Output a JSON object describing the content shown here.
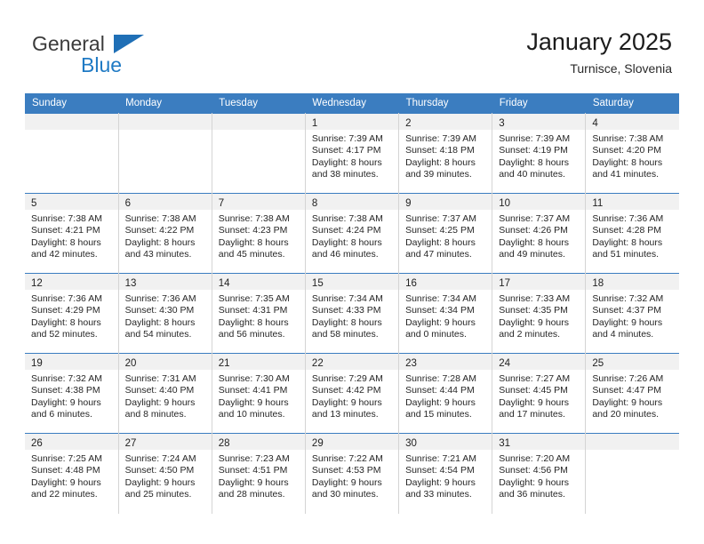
{
  "brand": {
    "name_top": "General",
    "name_bottom": "Blue",
    "triangle_color": "#1f6fb6",
    "text_color": "#3b3b3b",
    "blue_color": "#1f7ac4"
  },
  "header": {
    "title": "January 2025",
    "location": "Turnisce, Slovenia"
  },
  "theme": {
    "header_band": "#3b7dc0",
    "daynum_band": "#f1f1f1",
    "grid_line": "#d4d4d4",
    "text": "#262626"
  },
  "weekdays": [
    "Sunday",
    "Monday",
    "Tuesday",
    "Wednesday",
    "Thursday",
    "Friday",
    "Saturday"
  ],
  "weeks": [
    [
      {
        "day": "",
        "lines": []
      },
      {
        "day": "",
        "lines": []
      },
      {
        "day": "",
        "lines": []
      },
      {
        "day": "1",
        "lines": [
          "Sunrise: 7:39 AM",
          "Sunset: 4:17 PM",
          "Daylight: 8 hours",
          "and 38 minutes."
        ]
      },
      {
        "day": "2",
        "lines": [
          "Sunrise: 7:39 AM",
          "Sunset: 4:18 PM",
          "Daylight: 8 hours",
          "and 39 minutes."
        ]
      },
      {
        "day": "3",
        "lines": [
          "Sunrise: 7:39 AM",
          "Sunset: 4:19 PM",
          "Daylight: 8 hours",
          "and 40 minutes."
        ]
      },
      {
        "day": "4",
        "lines": [
          "Sunrise: 7:38 AM",
          "Sunset: 4:20 PM",
          "Daylight: 8 hours",
          "and 41 minutes."
        ]
      }
    ],
    [
      {
        "day": "5",
        "lines": [
          "Sunrise: 7:38 AM",
          "Sunset: 4:21 PM",
          "Daylight: 8 hours",
          "and 42 minutes."
        ]
      },
      {
        "day": "6",
        "lines": [
          "Sunrise: 7:38 AM",
          "Sunset: 4:22 PM",
          "Daylight: 8 hours",
          "and 43 minutes."
        ]
      },
      {
        "day": "7",
        "lines": [
          "Sunrise: 7:38 AM",
          "Sunset: 4:23 PM",
          "Daylight: 8 hours",
          "and 45 minutes."
        ]
      },
      {
        "day": "8",
        "lines": [
          "Sunrise: 7:38 AM",
          "Sunset: 4:24 PM",
          "Daylight: 8 hours",
          "and 46 minutes."
        ]
      },
      {
        "day": "9",
        "lines": [
          "Sunrise: 7:37 AM",
          "Sunset: 4:25 PM",
          "Daylight: 8 hours",
          "and 47 minutes."
        ]
      },
      {
        "day": "10",
        "lines": [
          "Sunrise: 7:37 AM",
          "Sunset: 4:26 PM",
          "Daylight: 8 hours",
          "and 49 minutes."
        ]
      },
      {
        "day": "11",
        "lines": [
          "Sunrise: 7:36 AM",
          "Sunset: 4:28 PM",
          "Daylight: 8 hours",
          "and 51 minutes."
        ]
      }
    ],
    [
      {
        "day": "12",
        "lines": [
          "Sunrise: 7:36 AM",
          "Sunset: 4:29 PM",
          "Daylight: 8 hours",
          "and 52 minutes."
        ]
      },
      {
        "day": "13",
        "lines": [
          "Sunrise: 7:36 AM",
          "Sunset: 4:30 PM",
          "Daylight: 8 hours",
          "and 54 minutes."
        ]
      },
      {
        "day": "14",
        "lines": [
          "Sunrise: 7:35 AM",
          "Sunset: 4:31 PM",
          "Daylight: 8 hours",
          "and 56 minutes."
        ]
      },
      {
        "day": "15",
        "lines": [
          "Sunrise: 7:34 AM",
          "Sunset: 4:33 PM",
          "Daylight: 8 hours",
          "and 58 minutes."
        ]
      },
      {
        "day": "16",
        "lines": [
          "Sunrise: 7:34 AM",
          "Sunset: 4:34 PM",
          "Daylight: 9 hours",
          "and 0 minutes."
        ]
      },
      {
        "day": "17",
        "lines": [
          "Sunrise: 7:33 AM",
          "Sunset: 4:35 PM",
          "Daylight: 9 hours",
          "and 2 minutes."
        ]
      },
      {
        "day": "18",
        "lines": [
          "Sunrise: 7:32 AM",
          "Sunset: 4:37 PM",
          "Daylight: 9 hours",
          "and 4 minutes."
        ]
      }
    ],
    [
      {
        "day": "19",
        "lines": [
          "Sunrise: 7:32 AM",
          "Sunset: 4:38 PM",
          "Daylight: 9 hours",
          "and 6 minutes."
        ]
      },
      {
        "day": "20",
        "lines": [
          "Sunrise: 7:31 AM",
          "Sunset: 4:40 PM",
          "Daylight: 9 hours",
          "and 8 minutes."
        ]
      },
      {
        "day": "21",
        "lines": [
          "Sunrise: 7:30 AM",
          "Sunset: 4:41 PM",
          "Daylight: 9 hours",
          "and 10 minutes."
        ]
      },
      {
        "day": "22",
        "lines": [
          "Sunrise: 7:29 AM",
          "Sunset: 4:42 PM",
          "Daylight: 9 hours",
          "and 13 minutes."
        ]
      },
      {
        "day": "23",
        "lines": [
          "Sunrise: 7:28 AM",
          "Sunset: 4:44 PM",
          "Daylight: 9 hours",
          "and 15 minutes."
        ]
      },
      {
        "day": "24",
        "lines": [
          "Sunrise: 7:27 AM",
          "Sunset: 4:45 PM",
          "Daylight: 9 hours",
          "and 17 minutes."
        ]
      },
      {
        "day": "25",
        "lines": [
          "Sunrise: 7:26 AM",
          "Sunset: 4:47 PM",
          "Daylight: 9 hours",
          "and 20 minutes."
        ]
      }
    ],
    [
      {
        "day": "26",
        "lines": [
          "Sunrise: 7:25 AM",
          "Sunset: 4:48 PM",
          "Daylight: 9 hours",
          "and 22 minutes."
        ]
      },
      {
        "day": "27",
        "lines": [
          "Sunrise: 7:24 AM",
          "Sunset: 4:50 PM",
          "Daylight: 9 hours",
          "and 25 minutes."
        ]
      },
      {
        "day": "28",
        "lines": [
          "Sunrise: 7:23 AM",
          "Sunset: 4:51 PM",
          "Daylight: 9 hours",
          "and 28 minutes."
        ]
      },
      {
        "day": "29",
        "lines": [
          "Sunrise: 7:22 AM",
          "Sunset: 4:53 PM",
          "Daylight: 9 hours",
          "and 30 minutes."
        ]
      },
      {
        "day": "30",
        "lines": [
          "Sunrise: 7:21 AM",
          "Sunset: 4:54 PM",
          "Daylight: 9 hours",
          "and 33 minutes."
        ]
      },
      {
        "day": "31",
        "lines": [
          "Sunrise: 7:20 AM",
          "Sunset: 4:56 PM",
          "Daylight: 9 hours",
          "and 36 minutes."
        ]
      },
      {
        "day": "",
        "lines": []
      }
    ]
  ]
}
